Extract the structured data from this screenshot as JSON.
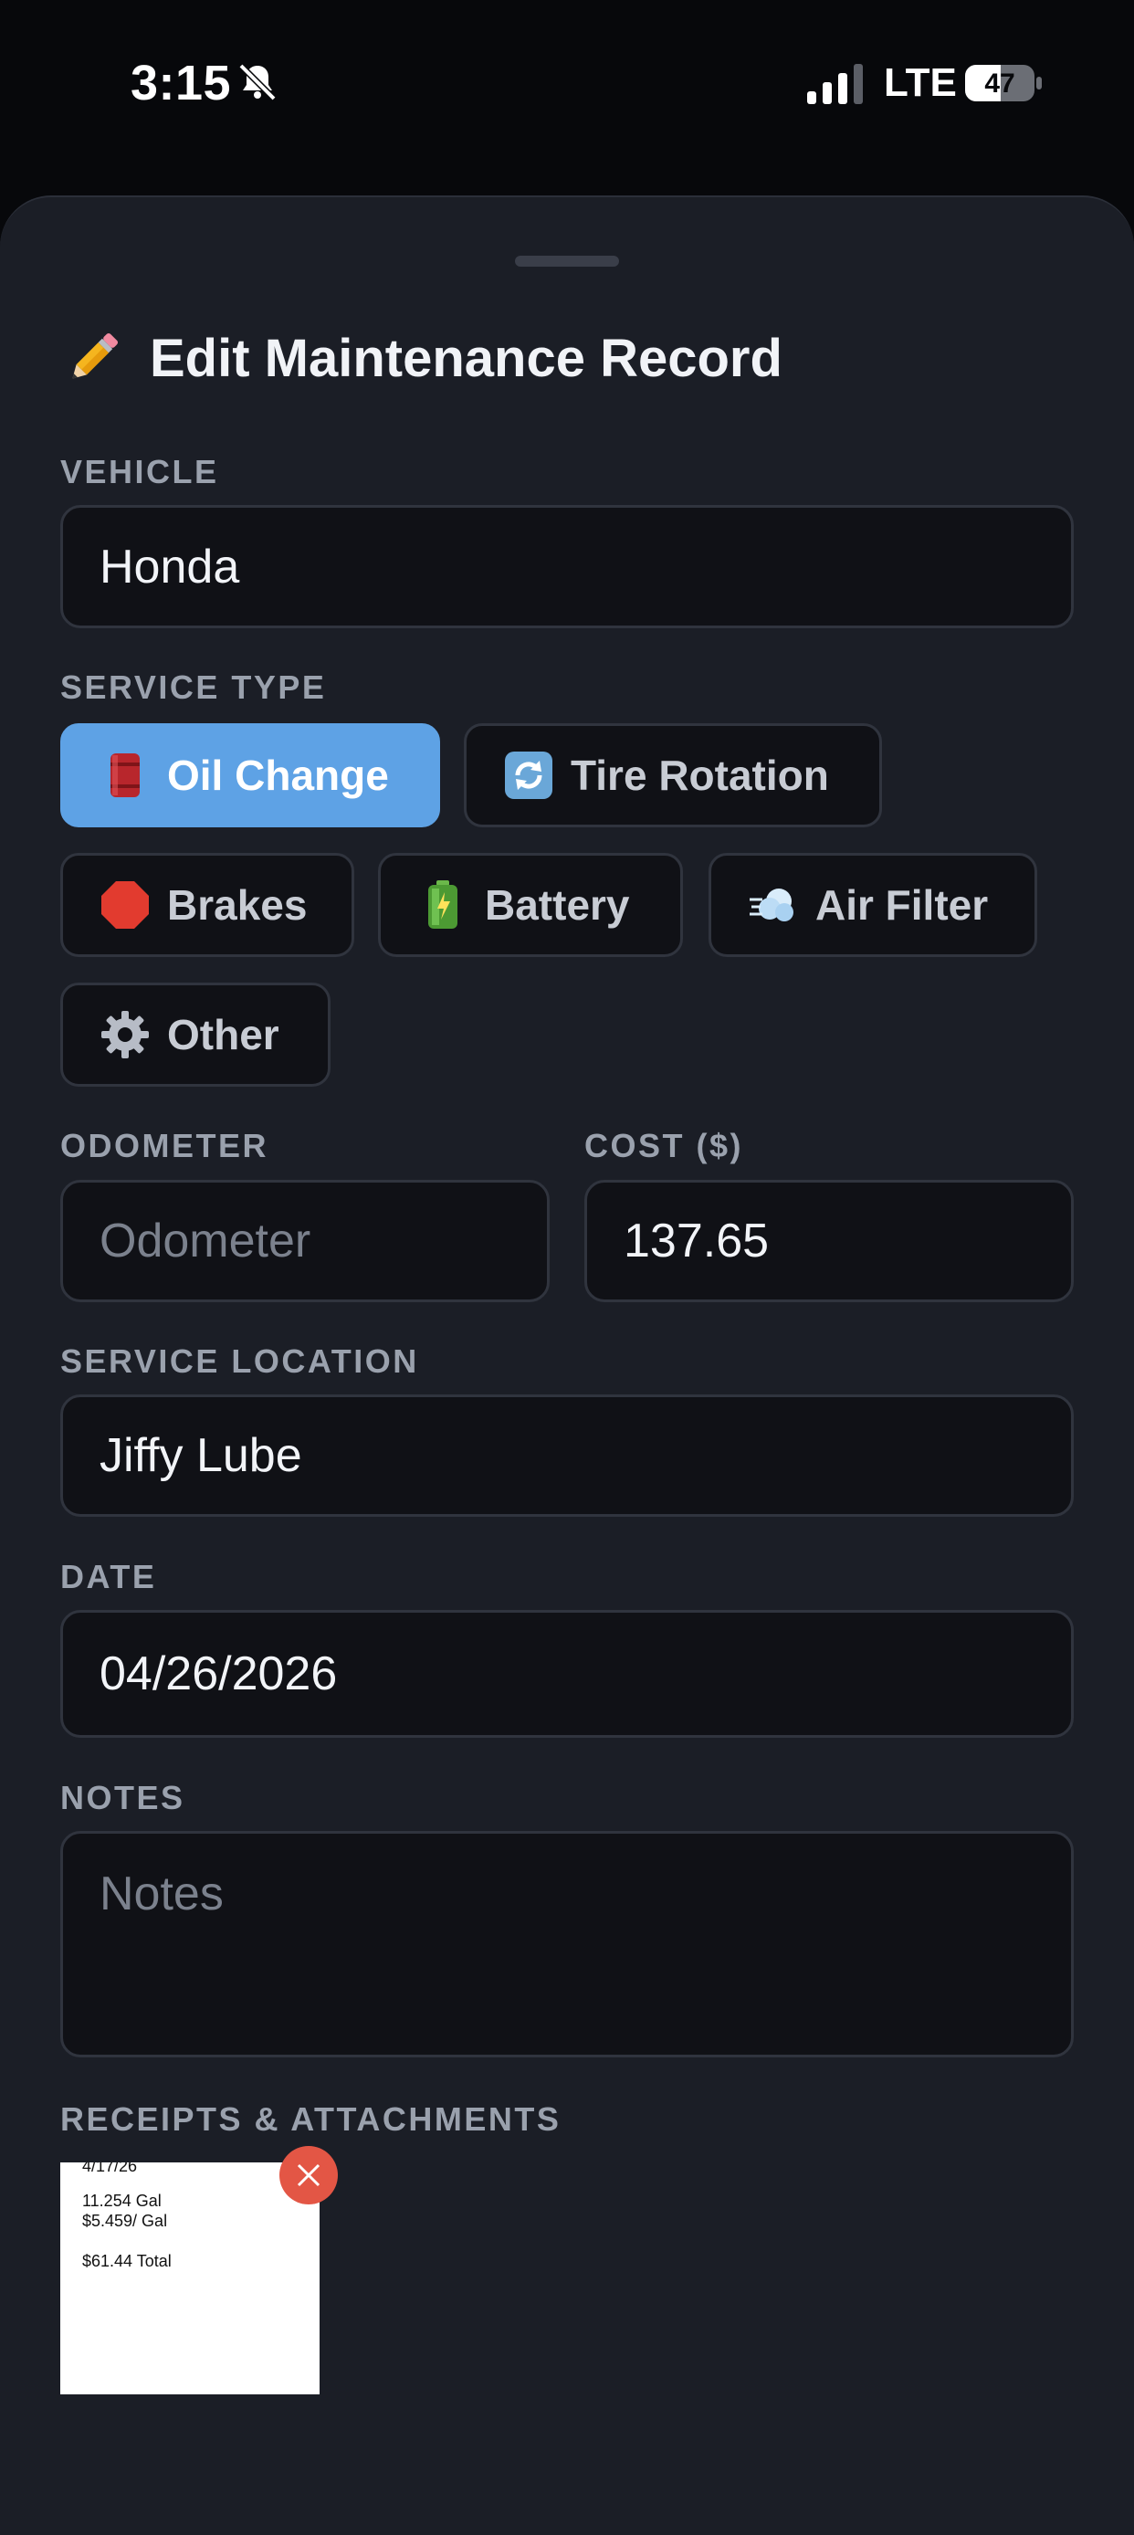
{
  "status_bar": {
    "time": "3:15",
    "network": "LTE",
    "battery": "47"
  },
  "sheet": {
    "title": "Edit Maintenance Record",
    "title_icon": "pencil-icon"
  },
  "vehicle": {
    "label": "VEHICLE",
    "value": "Honda"
  },
  "service_type": {
    "label": "SERVICE TYPE",
    "selected": "Oil Change",
    "options": [
      {
        "label": "Oil Change",
        "icon": "oil-drum-icon"
      },
      {
        "label": "Tire Rotation",
        "icon": "rotate-arrows-icon"
      },
      {
        "label": "Brakes",
        "icon": "stop-sign-icon"
      },
      {
        "label": "Battery",
        "icon": "battery-icon"
      },
      {
        "label": "Air Filter",
        "icon": "air-puff-icon"
      },
      {
        "label": "Other",
        "icon": "gear-icon"
      }
    ]
  },
  "odometer": {
    "label": "ODOMETER",
    "placeholder": "Odometer",
    "value": ""
  },
  "cost": {
    "label": "COST ($)",
    "value": "137.65"
  },
  "service_location": {
    "label": "SERVICE LOCATION",
    "value": "Jiffy Lube"
  },
  "date": {
    "label": "DATE",
    "value": "04/26/2026"
  },
  "notes": {
    "label": "NOTES",
    "placeholder": "Notes",
    "value": ""
  },
  "attachments": {
    "label": "RECEIPTS & ATTACHMENTS",
    "items": [
      {
        "lines": [
          "4/17/26",
          "11.254 Gal",
          "$5.459/ Gal",
          "$61.44 Total"
        ]
      }
    ]
  },
  "colors": {
    "accent": "#5ea2e5",
    "sheet_bg": "#1b1e26",
    "field_bg": "#101116",
    "remove": "#e35645"
  }
}
